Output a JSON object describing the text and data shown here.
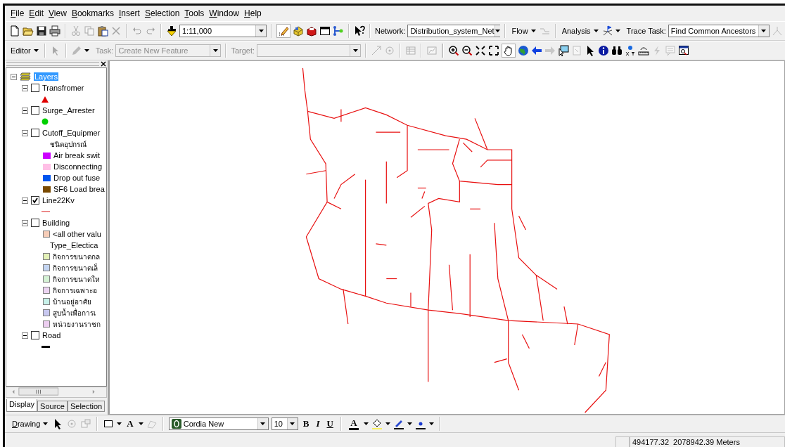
{
  "menu_bar": [
    {
      "label": "File"
    },
    {
      "label": "Edit"
    },
    {
      "label": "View"
    },
    {
      "label": "Bookmarks"
    },
    {
      "label": "Insert"
    },
    {
      "label": "Selection"
    },
    {
      "label": "Tools"
    },
    {
      "label": "Window"
    },
    {
      "label": "Help"
    }
  ],
  "standard_toolbar": {
    "scale": "1:11,000"
  },
  "network_toolbar": {
    "network_label": "Network:",
    "network": "Distribution_system_Net",
    "flow": "Flow",
    "analysis": "Analysis",
    "trace_task_label": "Trace Task:",
    "trace_task": "Find Common Ancestors"
  },
  "editor_toolbar": {
    "editor": "Editor",
    "task_label": "Task:",
    "task": "Create New Feature",
    "target_label": "Target:",
    "disabled": true
  },
  "toc": {
    "root": {
      "label": "Layers",
      "selected": true
    },
    "layers": [
      {
        "name": "Transfromer",
        "checked": false,
        "expanded": true,
        "legend": [
          {
            "kind": "triangle",
            "color": "#e00000"
          }
        ]
      },
      {
        "name": "Surge_Arrester",
        "checked": false,
        "expanded": true,
        "legend": [
          {
            "kind": "circle",
            "color": "#00d000"
          }
        ]
      },
      {
        "name": "Cutoff_Equipmer",
        "checked": false,
        "expanded": true,
        "legend": [
          {
            "kind": "heading",
            "label": "ชนิดอุปกรณ์"
          },
          {
            "kind": "swatch",
            "color": "#cc00ff",
            "label": "Air break swit"
          },
          {
            "kind": "swatch",
            "color": "#ffbfe6",
            "label": "Disconnecting"
          },
          {
            "kind": "swatch",
            "color": "#0055ee",
            "label": "Drop out fuse"
          },
          {
            "kind": "swatch",
            "color": "#7a4a00",
            "label": "SF6 Load brea"
          }
        ]
      },
      {
        "name": "Line22Kv",
        "checked": true,
        "expanded": true,
        "legend": [
          {
            "kind": "line",
            "color": "#e86a6a"
          }
        ]
      },
      {
        "name": "Building",
        "checked": false,
        "expanded": true,
        "legend": [
          {
            "kind": "swatch",
            "color": "#f6cdb8",
            "label": "<all other valu"
          },
          {
            "kind": "heading",
            "label": "Type_Electica"
          },
          {
            "kind": "swatch",
            "color": "#e4f2b8",
            "label": "กิจการขนาดกล"
          },
          {
            "kind": "swatch",
            "color": "#c4d5f2",
            "label": "กิจการขนาดเล็"
          },
          {
            "kind": "swatch",
            "color": "#d4f2d4",
            "label": "กิจการขนาดให"
          },
          {
            "kind": "swatch",
            "color": "#ecd4f2",
            "label": "กิจการเฉพาะอ"
          },
          {
            "kind": "swatch",
            "color": "#c8f2ea",
            "label": "บ้านอยู่อาศัย"
          },
          {
            "kind": "swatch",
            "color": "#c8c8f0",
            "label": "สูบน้ำเพื่อการเ"
          },
          {
            "kind": "swatch",
            "color": "#eccef0",
            "label": "หน่วยงานราชก"
          }
        ]
      },
      {
        "name": "Road",
        "checked": false,
        "expanded": true,
        "legend": [
          {
            "kind": "line",
            "color": "#000000"
          }
        ]
      }
    ],
    "tabs": [
      {
        "label": "Display",
        "selected": true
      },
      {
        "label": "Source",
        "selected": false
      },
      {
        "label": "Selection",
        "selected": false
      }
    ]
  },
  "drawing_toolbar": {
    "label": "Drawing",
    "new_text": "A",
    "font": "Cordia New",
    "font_size": "10",
    "bold": "B",
    "italic": "I",
    "underline": "U",
    "font_color": "A"
  },
  "status_bar": {
    "coordinates": "494177.32  2078942.39 Meters"
  }
}
